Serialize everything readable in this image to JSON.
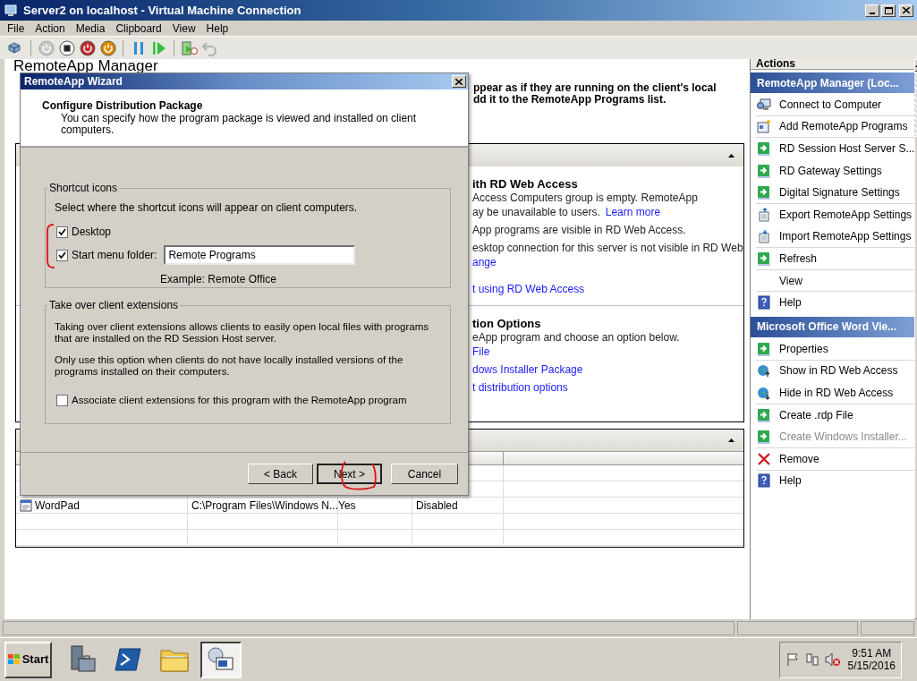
{
  "window": {
    "title": "Server2 on localhost - Virtual Machine Connection"
  },
  "menu": [
    "File",
    "Action",
    "Media",
    "Clipboard",
    "View",
    "Help"
  ],
  "toolbar": [
    [
      {
        "kind": "ctrl_alt_del",
        "disabled": false
      }
    ],
    [
      {
        "kind": "start",
        "disabled": true
      },
      {
        "kind": "turn_off",
        "disabled": false
      },
      {
        "kind": "shutdown",
        "disabled": false
      },
      {
        "kind": "save",
        "disabled": false
      }
    ],
    [
      {
        "kind": "pause",
        "disabled": false
      },
      {
        "kind": "reset",
        "disabled": false
      }
    ],
    [
      {
        "kind": "snapshot",
        "disabled": false
      },
      {
        "kind": "revert",
        "disabled": true
      }
    ]
  ],
  "manager": {
    "heading": "RemoteApp Manager",
    "intro": [
      "ppear as if they are running on the client's local",
      "dd it to the RemoteApp Programs list."
    ]
  },
  "sections": [
    {
      "title": "ith RD Web Access",
      "groups": [
        [
          [
            {
              "text": "Access Computers group is empty. RemoteApp",
              "link": false
            }
          ],
          [
            {
              "text": "ay be unavailable to users.",
              "link": false
            },
            {
              "text": "Learn more",
              "link": true
            }
          ]
        ],
        [
          [
            {
              "text": "App programs are visible in RD Web Access.",
              "link": false
            }
          ]
        ],
        [
          [
            {
              "text": "esktop connection for this server is not visible in RD Web",
              "link": false
            }
          ],
          [
            {
              "text": "ange",
              "link": true
            }
          ]
        ],
        [
          [
            {
              "text": "t using RD Web Access",
              "link": true
            }
          ]
        ]
      ]
    },
    {
      "title": "tion Options",
      "groups": [
        [
          [
            {
              "text": "eApp program and choose an option below.",
              "link": false
            }
          ],
          [
            {
              "text": "File",
              "link": true
            }
          ]
        ],
        [
          [
            {
              "text": "dows Installer Package",
              "link": true
            }
          ]
        ],
        [
          [
            {
              "text": "t distribution options",
              "link": true
            }
          ]
        ]
      ]
    }
  ],
  "programs_table": {
    "rows": [
      {
        "kind": "wordpad",
        "cells": [
          "WordPad",
          "C:\\Program Files\\Windows N...",
          "Yes",
          "Disabled"
        ]
      }
    ]
  },
  "actions": {
    "title": "Actions",
    "groups": [
      {
        "title": "RemoteApp Manager (Loc...",
        "items": [
          {
            "label": "Connect to Computer",
            "kind": "computer",
            "disabled": false,
            "divider": true
          },
          {
            "label": "Add RemoteApp Programs",
            "kind": "add",
            "disabled": false,
            "divider": true
          },
          {
            "label": "RD Session Host Server S...",
            "kind": "arrow",
            "disabled": false,
            "divider": false
          },
          {
            "label": "RD Gateway Settings",
            "kind": "arrow",
            "disabled": false,
            "divider": false
          },
          {
            "label": "Digital Signature Settings",
            "kind": "arrow",
            "disabled": false,
            "divider": true
          },
          {
            "label": "Export RemoteApp Settings",
            "kind": "export",
            "disabled": false,
            "divider": false
          },
          {
            "label": "Import RemoteApp Settings",
            "kind": "import",
            "disabled": false,
            "divider": true
          },
          {
            "label": "Refresh",
            "kind": "arrow",
            "disabled": false,
            "divider": true
          },
          {
            "label": "View",
            "kind": "none",
            "disabled": false,
            "divider": true
          },
          {
            "label": "Help",
            "kind": "help",
            "disabled": false,
            "divider": false
          }
        ]
      },
      {
        "title": "Microsoft Office Word Vie...",
        "items": [
          {
            "label": "Properties",
            "kind": "arrow",
            "disabled": false,
            "divider": true
          },
          {
            "label": "Show in RD Web Access",
            "kind": "globe_up",
            "disabled": false,
            "divider": false
          },
          {
            "label": "Hide in RD Web Access",
            "kind": "globe_down",
            "disabled": false,
            "divider": true
          },
          {
            "label": "Create .rdp File",
            "kind": "arrow",
            "disabled": false,
            "divider": false
          },
          {
            "label": "Create Windows Installer...",
            "kind": "arrow",
            "disabled": true,
            "divider": true
          },
          {
            "label": "Remove",
            "kind": "remove",
            "disabled": false,
            "divider": true
          },
          {
            "label": "Help",
            "kind": "help",
            "disabled": false,
            "divider": false
          }
        ]
      }
    ]
  },
  "wizard": {
    "title": "RemoteApp Wizard",
    "heading": "Configure Distribution Package",
    "subtitle": "You can specify how the program package is viewed and installed on client computers.",
    "shortcut_group": {
      "legend": "Shortcut icons",
      "hint": "Select where the shortcut icons will appear on client computers.",
      "desktop": {
        "label": "Desktop",
        "checked": true
      },
      "start_menu": {
        "label": "Start menu folder:",
        "checked": true,
        "value": "Remote Programs"
      },
      "example": "Example: Remote Office"
    },
    "extensions_group": {
      "legend": "Take over client extensions",
      "paragraphs": [
        "Taking over client extensions allows clients to easily open local files with programs that are installed on the RD Session Host server.",
        "Only use this option when clients do not have locally installed versions of the programs installed on their computers."
      ],
      "associate": {
        "label": "Associate client extensions for this program with the RemoteApp program",
        "checked": false
      }
    },
    "buttons": [
      {
        "label": "< Back",
        "default": false
      },
      {
        "label": "Next >",
        "default": true
      },
      {
        "label": "Cancel",
        "default": false
      }
    ]
  },
  "annotations": [
    {
      "kind": "bracket"
    },
    {
      "kind": "circle"
    }
  ],
  "taskbar": {
    "start": "Start",
    "apps": [
      {
        "kind": "server_manager",
        "selected": false
      },
      {
        "kind": "powershell",
        "selected": false
      },
      {
        "kind": "explorer",
        "selected": false
      },
      {
        "kind": "remoteapp",
        "selected": true
      }
    ],
    "tray": [
      {
        "kind": "flag"
      },
      {
        "kind": "network"
      },
      {
        "kind": "volume_muted"
      }
    ],
    "time": "9:51 AM",
    "date": "5/15/2016"
  }
}
